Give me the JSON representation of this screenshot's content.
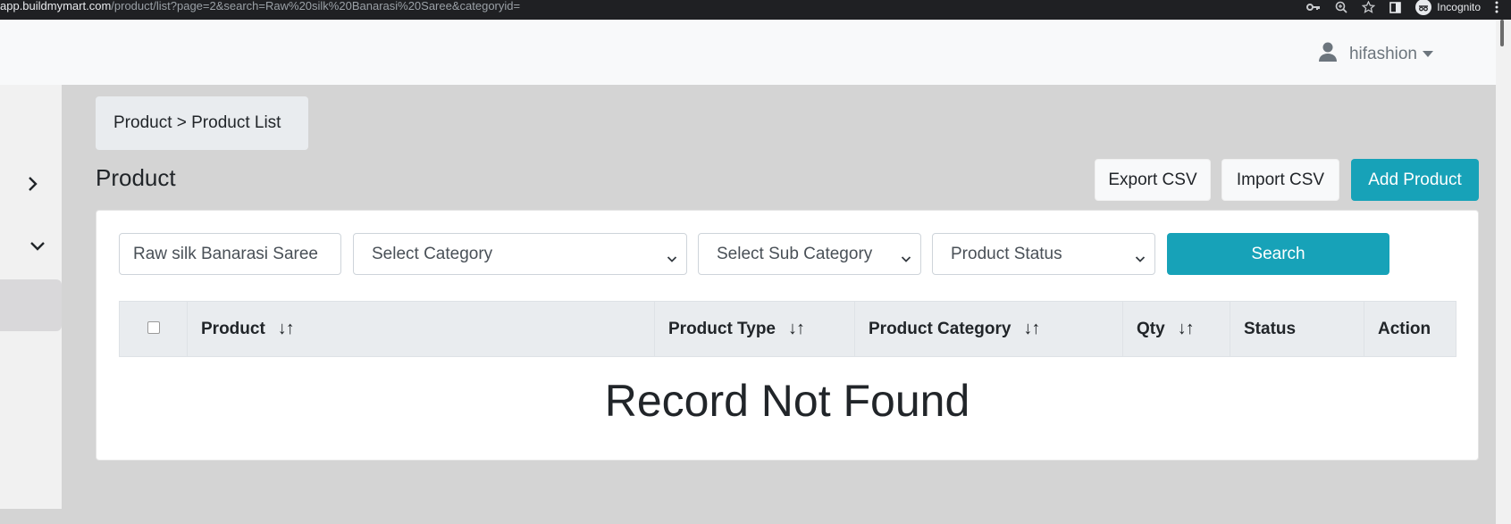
{
  "browser": {
    "url_host": "app.buildmymart.com",
    "url_path": "/product/list?page=2&search=Raw%20silk%20Banarasi%20Saree&categoryid=",
    "incognito_label": "Incognito"
  },
  "topbar": {
    "username": "hifashion"
  },
  "breadcrumb": {
    "text": "Product > Product List"
  },
  "page": {
    "title": "Product"
  },
  "actions": {
    "export_label": "Export CSV",
    "import_label": "Import CSV",
    "add_label": "Add Product"
  },
  "filters": {
    "search_value": "Raw silk Banarasi Saree",
    "category_selected": "Select Category",
    "subcategory_selected": "Select Sub Category",
    "status_selected": "Product Status",
    "search_button_label": "Search"
  },
  "table": {
    "columns": {
      "product": "Product",
      "type": "Product Type",
      "category": "Product Category",
      "qty": "Qty",
      "status": "Status",
      "action": "Action"
    },
    "sort_glyph": "↓↑",
    "empty_message": "Record Not Found"
  },
  "colors": {
    "accent": "#17a2b8",
    "page_bg": "#d4d4d4",
    "header_bg": "#e9ecef"
  }
}
